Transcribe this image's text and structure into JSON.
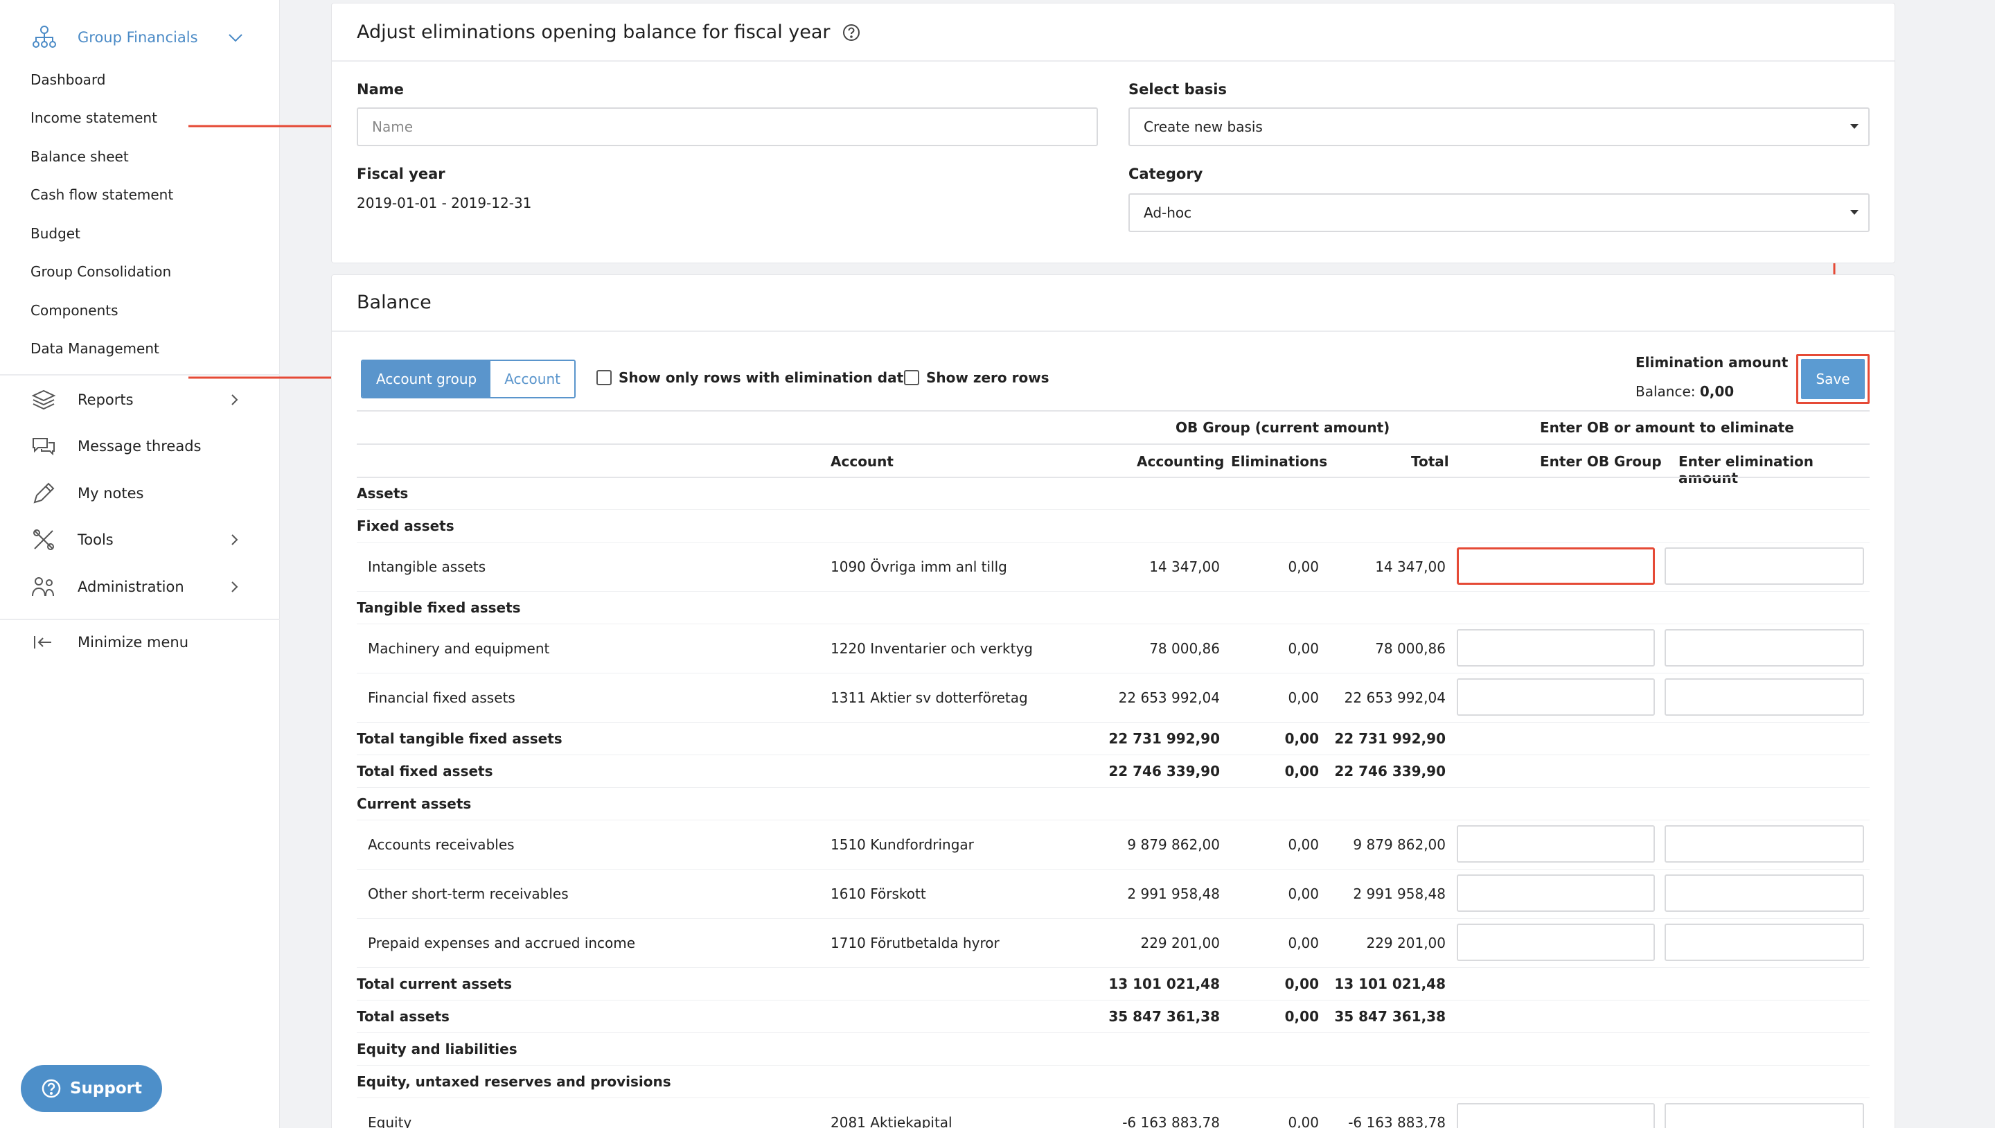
{
  "sidebar": {
    "group_title": "Group Financials",
    "sub_items": [
      {
        "label": "Dashboard"
      },
      {
        "label": "Income statement"
      },
      {
        "label": "Balance sheet"
      },
      {
        "label": "Cash flow statement"
      },
      {
        "label": "Budget"
      },
      {
        "label": "Group Consolidation"
      },
      {
        "label": "Components"
      },
      {
        "label": "Data Management"
      }
    ],
    "main_items": [
      {
        "label": "Reports",
        "icon": "layers-icon",
        "has_chevron": true
      },
      {
        "label": "Message threads",
        "icon": "chat-icon",
        "has_chevron": false
      },
      {
        "label": "My notes",
        "icon": "pencil-icon",
        "has_chevron": false
      },
      {
        "label": "Tools",
        "icon": "tools-icon",
        "has_chevron": true
      },
      {
        "label": "Administration",
        "icon": "users-icon",
        "has_chevron": true
      }
    ],
    "minimize_label": "Minimize menu",
    "support_label": "Support"
  },
  "form": {
    "title": "Adjust eliminations opening balance for fiscal year",
    "name_label": "Name",
    "name_placeholder": "Name",
    "name_value": "",
    "basis_label": "Select basis",
    "basis_value": "Create new basis",
    "fiscal_year_label": "Fiscal year",
    "fiscal_year_value": "2019-01-01 - 2019-12-31",
    "category_label": "Category",
    "category_value": "Ad-hoc"
  },
  "balance": {
    "title": "Balance",
    "toggle": {
      "active": "Account group",
      "inactive": "Account"
    },
    "checkbox_only_elim": "Show only rows with elimination data",
    "checkbox_zero_rows": "Show zero rows",
    "elimination_amount_label": "Elimination amount",
    "balance_label": "Balance:",
    "balance_value": "0,00",
    "save_label": "Save",
    "group_header_ob": "OB Group (current amount)",
    "group_header_enter": "Enter OB or amount to eliminate",
    "col_account": "Account",
    "col_accounting": "Accounting",
    "col_eliminations": "Eliminations",
    "col_total": "Total",
    "col_enter_ob": "Enter OB Group",
    "col_enter_elim": "Enter elimination amount",
    "rows": [
      {
        "type": "section",
        "label": "Assets"
      },
      {
        "type": "section",
        "label": "Fixed assets"
      },
      {
        "type": "data",
        "label": "Intangible assets",
        "account": "1090 Övriga imm anl tillg",
        "accounting": "14 347,00",
        "eliminations": "0,00",
        "total": "14 347,00",
        "highlight": true
      },
      {
        "type": "section",
        "label": "Tangible fixed assets"
      },
      {
        "type": "data",
        "label": "Machinery and equipment",
        "account": "1220 Inventarier och verktyg",
        "accounting": "78 000,86",
        "eliminations": "0,00",
        "total": "78 000,86"
      },
      {
        "type": "data",
        "label": "Financial fixed assets",
        "account": "1311 Aktier sv dotterföretag",
        "accounting": "22 653 992,04",
        "eliminations": "0,00",
        "total": "22 653 992,04"
      },
      {
        "type": "total",
        "label": "Total tangible fixed assets",
        "accounting": "22 731 992,90",
        "eliminations": "0,00",
        "total": "22 731 992,90"
      },
      {
        "type": "total",
        "label": "Total fixed assets",
        "accounting": "22 746 339,90",
        "eliminations": "0,00",
        "total": "22 746 339,90"
      },
      {
        "type": "section",
        "label": "Current assets"
      },
      {
        "type": "data",
        "label": "Accounts receivables",
        "account": "1510 Kundfordringar",
        "accounting": "9 879 862,00",
        "eliminations": "0,00",
        "total": "9 879 862,00"
      },
      {
        "type": "data",
        "label": "Other short-term receivables",
        "account": "1610 Förskott",
        "accounting": "2 991 958,48",
        "eliminations": "0,00",
        "total": "2 991 958,48"
      },
      {
        "type": "data",
        "label": "Prepaid expenses and accrued income",
        "account": "1710 Förutbetalda hyror",
        "accounting": "229 201,00",
        "eliminations": "0,00",
        "total": "229 201,00"
      },
      {
        "type": "total",
        "label": "Total current assets",
        "accounting": "13 101 021,48",
        "eliminations": "0,00",
        "total": "13 101 021,48"
      },
      {
        "type": "total",
        "label": "Total assets",
        "accounting": "35 847 361,38",
        "eliminations": "0,00",
        "total": "35 847 361,38"
      },
      {
        "type": "section",
        "label": "Equity and liabilities"
      },
      {
        "type": "section",
        "label": "Equity, untaxed reserves and provisions"
      },
      {
        "type": "data",
        "label": "Equity",
        "account": "2081 Aktiekapital",
        "accounting": "-6 163 883,78",
        "eliminations": "0,00",
        "total": "-6 163 883,78"
      }
    ]
  },
  "colors": {
    "accent": "#5a95cc",
    "arrow": "#e54a36",
    "brand": "#4a8ac6"
  }
}
